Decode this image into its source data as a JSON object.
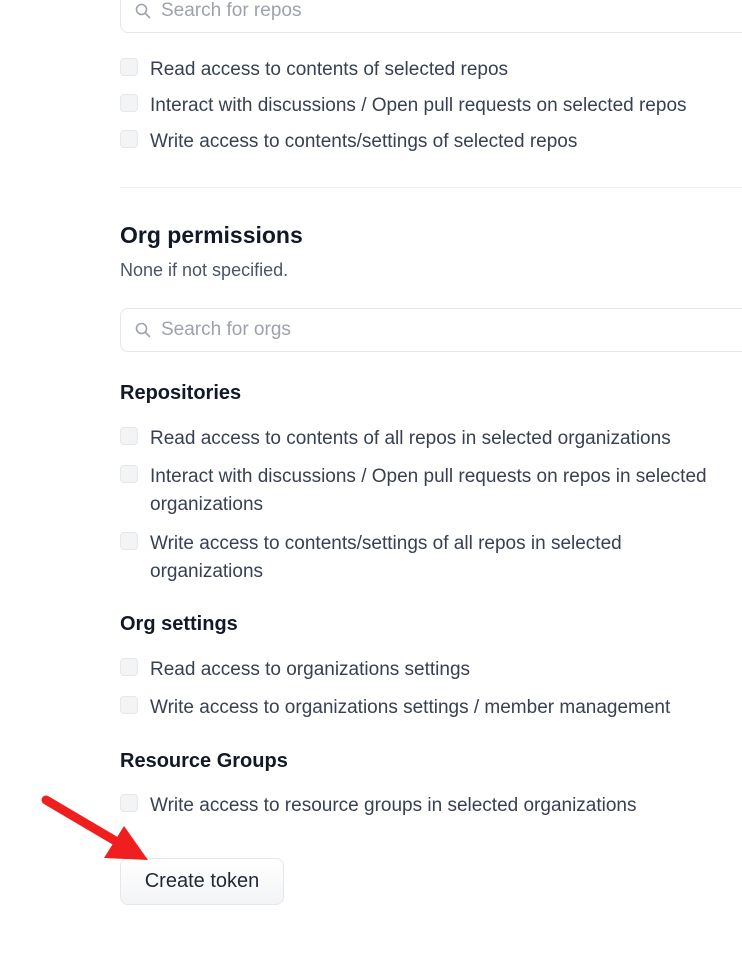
{
  "repo_search": {
    "placeholder": "Search for repos"
  },
  "repo_permissions": [
    "Read access to contents of selected repos",
    "Interact with discussions / Open pull requests on selected repos",
    "Write access to contents/settings of selected repos"
  ],
  "org_permissions": {
    "title": "Org permissions",
    "subtitle": "None if not specified.",
    "search_placeholder": "Search for orgs",
    "repositories": {
      "title": "Repositories",
      "items": [
        "Read access to contents of all repos in selected organizations",
        "Interact with discussions / Open pull requests on repos in selected organizations",
        "Write access to contents/settings of all repos in selected organizations"
      ]
    },
    "org_settings": {
      "title": "Org settings",
      "items": [
        "Read access to organizations settings",
        "Write access to organizations settings / member management"
      ]
    },
    "resource_groups": {
      "title": "Resource Groups",
      "items": [
        "Write access to resource groups in selected organizations"
      ]
    }
  },
  "create_token_label": "Create token",
  "icons": {
    "search": "search-icon",
    "annotation": "red-arrow-annotation"
  },
  "colors": {
    "arrow": "#f01f1f",
    "border": "#e5e7eb",
    "text": "#374151",
    "heading": "#111827"
  }
}
